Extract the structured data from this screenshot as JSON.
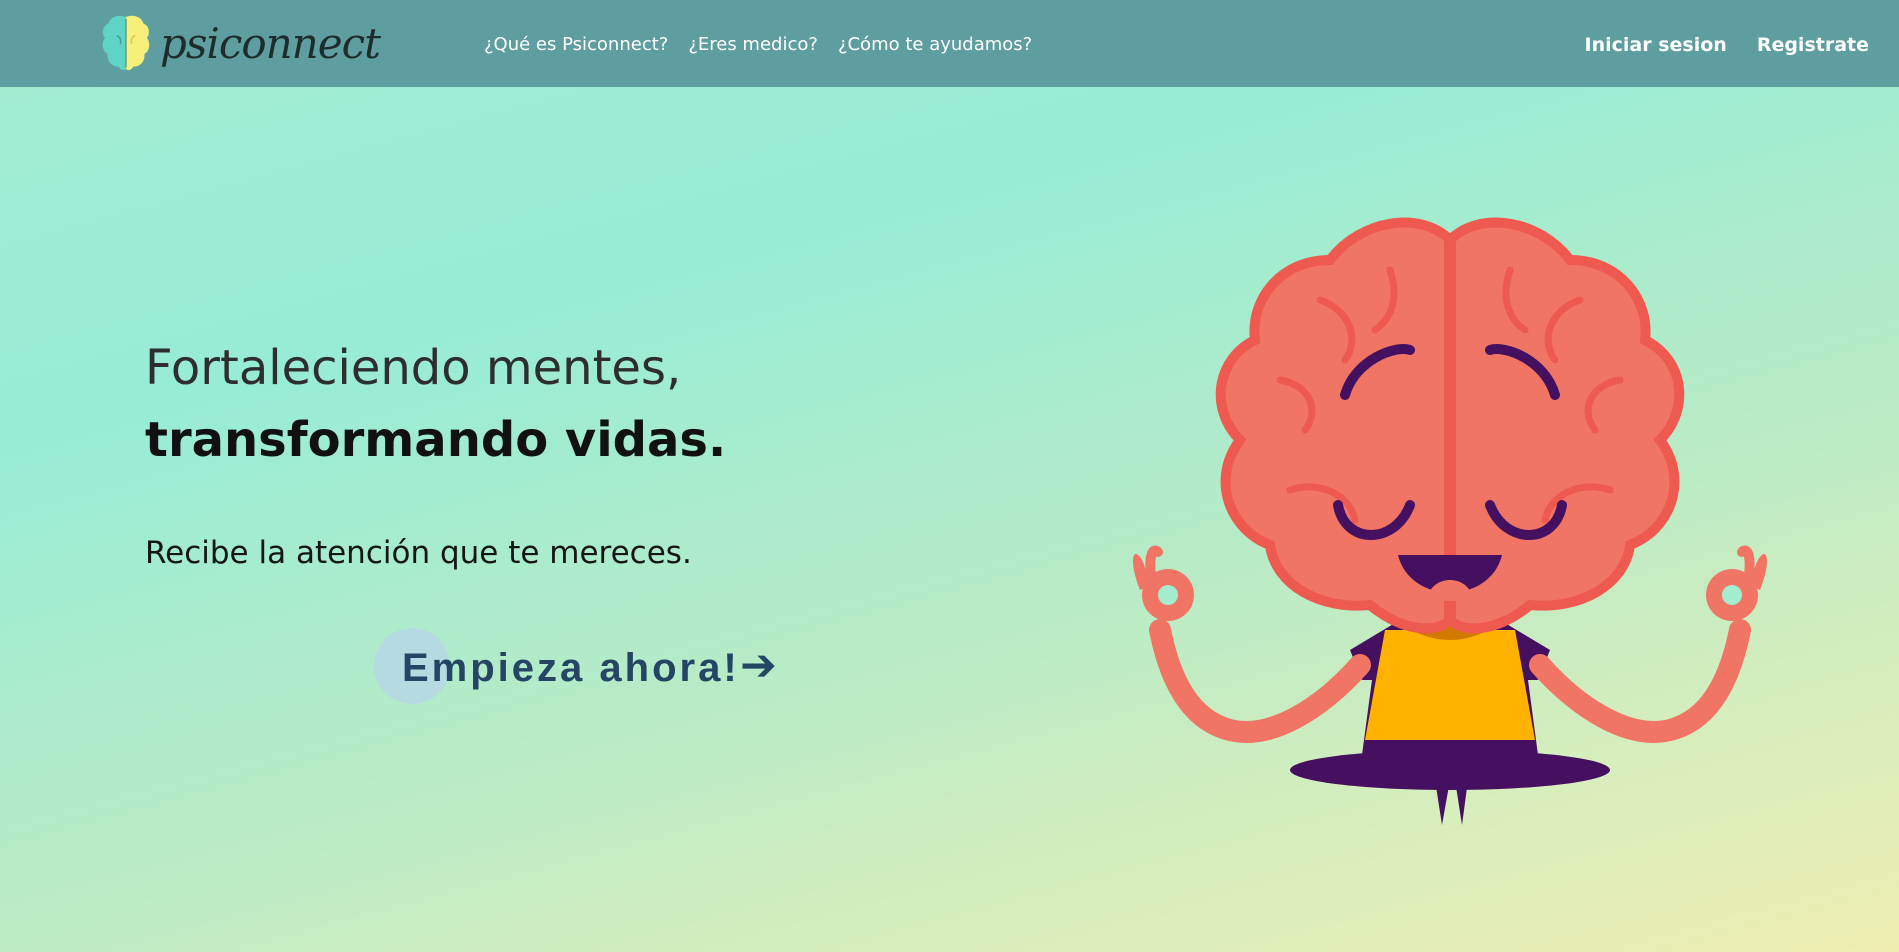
{
  "brand": {
    "name": "psiconnect"
  },
  "nav": {
    "links": [
      "¿Qué es Psiconnect?",
      "¿Eres medico?",
      "¿Cómo te ayudamos?"
    ],
    "login": "Iniciar sesion",
    "register": "Registrate"
  },
  "hero": {
    "line1": "Fortaleciendo mentes,",
    "line2": "transformando vidas.",
    "subtitle": "Recibe la atención que te mereces.",
    "cta_label": "Empieza ahora!",
    "cta_arrow": "➔"
  },
  "colors": {
    "navbar": "#5f9ea0",
    "cta_text": "#244563",
    "brain": "#f07565",
    "shirt": "#ffb300"
  }
}
